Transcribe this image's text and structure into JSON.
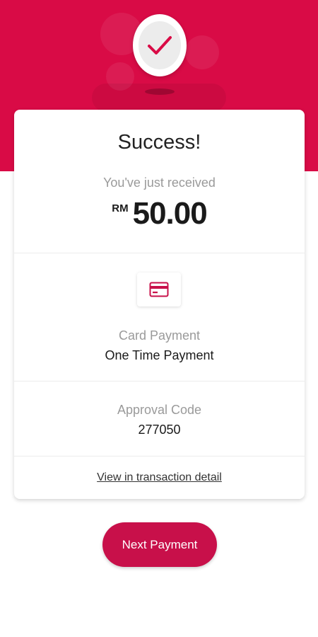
{
  "theme": {
    "accent": "#d90b46",
    "button": "#c8104a",
    "check": "#d90b46"
  },
  "header": {
    "icon": "check-icon"
  },
  "card": {
    "title": "Success!",
    "subtitle": "You've just received",
    "currency": "RM",
    "amount": "50.00",
    "payment_icon": "credit-card-icon",
    "payment_method_label": "Card Payment",
    "payment_method_value": "One Time Payment",
    "approval_label": "Approval Code",
    "approval_value": "277050",
    "transaction_link": "View in transaction detail"
  },
  "actions": {
    "next_payment_label": "Next Payment"
  }
}
